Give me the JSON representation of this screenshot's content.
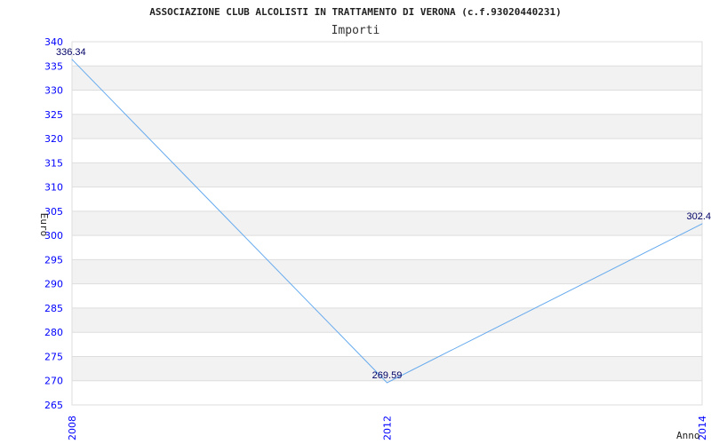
{
  "chart_data": {
    "type": "line",
    "title": "ASSOCIAZIONE CLUB ALCOLISTI IN TRATTAMENTO DI VERONA (c.f.93020440231)",
    "subtitle": "Importi",
    "xlabel": "Anno",
    "ylabel": "Euro",
    "categories": [
      "2008",
      "2012",
      "2014"
    ],
    "values": [
      336.34,
      269.59,
      302.4
    ],
    "data_labels": [
      "336.34",
      "269.59",
      "302.4"
    ],
    "ylim": [
      265,
      340
    ],
    "yticks": [
      265,
      270,
      275,
      280,
      285,
      290,
      295,
      300,
      305,
      310,
      315,
      320,
      325,
      330,
      335,
      340
    ],
    "grid": true,
    "line_color": "#66aaee",
    "tick_color": "#0000ff",
    "band_color": "#f2f2f2"
  }
}
